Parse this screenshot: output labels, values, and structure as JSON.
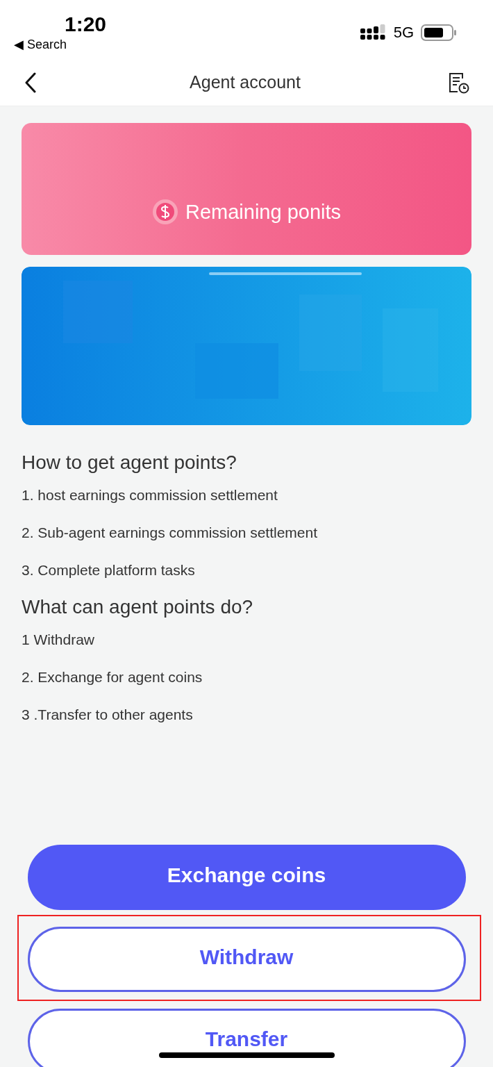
{
  "status_bar": {
    "time": "1:20",
    "back_label": "◀ Search",
    "network": "5G"
  },
  "header": {
    "title": "Agent account"
  },
  "points_card": {
    "label": "Remaining ponits"
  },
  "sections": [
    {
      "heading": "How to get agent points?",
      "items": [
        "1. host earnings commission settlement",
        "2. Sub-agent earnings commission settlement",
        "3. Complete platform tasks"
      ]
    },
    {
      "heading": "What can agent points do?",
      "items": [
        "1 Withdraw",
        "2. Exchange for agent coins",
        "3 .Transfer to other agents"
      ]
    }
  ],
  "buttons": [
    {
      "label": "Exchange coins",
      "kind": "filled",
      "highlighted": false
    },
    {
      "label": "Withdraw",
      "kind": "outline",
      "highlighted": true
    },
    {
      "label": "Transfer",
      "kind": "outline",
      "highlighted": false
    }
  ]
}
